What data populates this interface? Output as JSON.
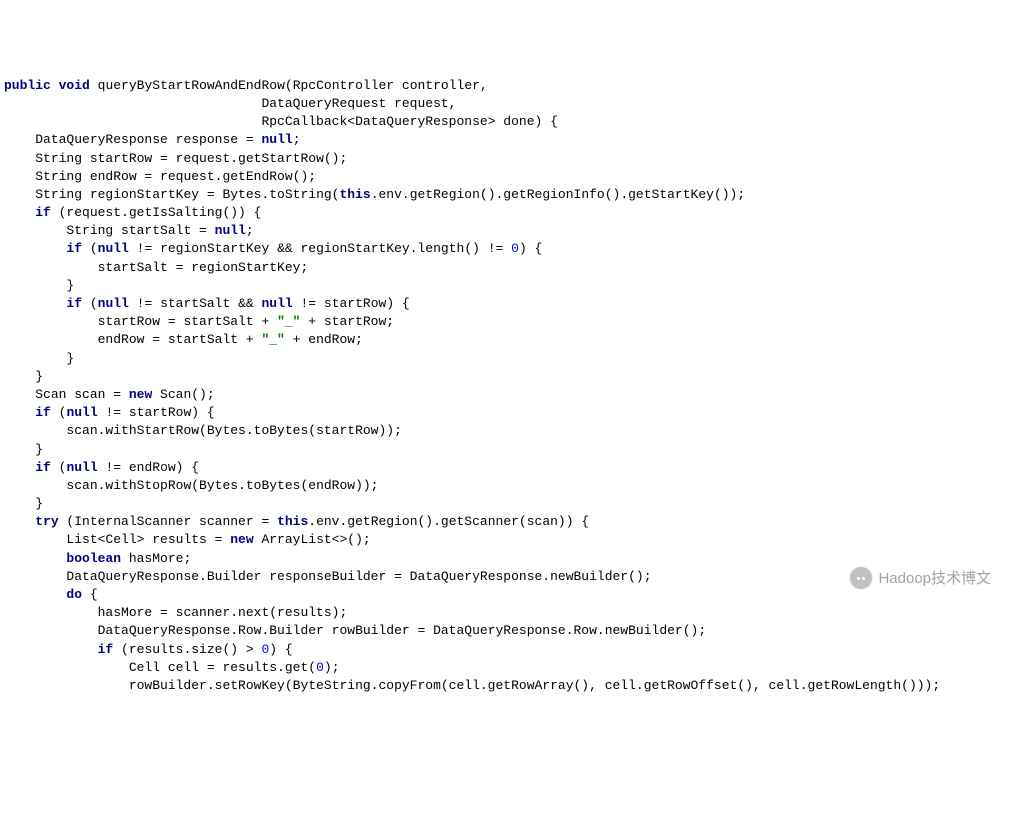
{
  "code": {
    "lines": [
      {
        "indent": 0,
        "tokens": [
          {
            "t": "kw",
            "v": "public"
          },
          {
            "t": "sp",
            "v": " "
          },
          {
            "t": "kw",
            "v": "void"
          },
          {
            "t": "sp",
            "v": " "
          },
          {
            "t": "txt",
            "v": "queryByStartRowAndEndRow(RpcController controller,"
          }
        ]
      },
      {
        "indent": 33,
        "tokens": [
          {
            "t": "txt",
            "v": "DataQueryRequest request,"
          }
        ]
      },
      {
        "indent": 33,
        "tokens": [
          {
            "t": "txt",
            "v": "RpcCallback<DataQueryResponse> done) {"
          }
        ]
      },
      {
        "indent": 4,
        "tokens": [
          {
            "t": "txt",
            "v": "DataQueryResponse response = "
          },
          {
            "t": "kw",
            "v": "null"
          },
          {
            "t": "txt",
            "v": ";"
          }
        ]
      },
      {
        "indent": 4,
        "tokens": [
          {
            "t": "txt",
            "v": "String startRow = request.getStartRow();"
          }
        ]
      },
      {
        "indent": 4,
        "tokens": [
          {
            "t": "txt",
            "v": "String endRow = request.getEndRow();"
          }
        ]
      },
      {
        "indent": 4,
        "tokens": [
          {
            "t": "txt",
            "v": "String regionStartKey = Bytes.toString("
          },
          {
            "t": "kw",
            "v": "this"
          },
          {
            "t": "txt",
            "v": ".env.getRegion().getRegionInfo().getStartKey());"
          }
        ]
      },
      {
        "indent": 4,
        "tokens": [
          {
            "t": "kw",
            "v": "if"
          },
          {
            "t": "txt",
            "v": " (request.getIsSalting()) {"
          }
        ]
      },
      {
        "indent": 8,
        "tokens": [
          {
            "t": "txt",
            "v": "String startSalt = "
          },
          {
            "t": "kw",
            "v": "null"
          },
          {
            "t": "txt",
            "v": ";"
          }
        ]
      },
      {
        "indent": 8,
        "tokens": [
          {
            "t": "kw",
            "v": "if"
          },
          {
            "t": "txt",
            "v": " ("
          },
          {
            "t": "kw",
            "v": "null"
          },
          {
            "t": "txt",
            "v": " != regionStartKey && regionStartKey.length() != "
          },
          {
            "t": "num",
            "v": "0"
          },
          {
            "t": "txt",
            "v": ") {"
          }
        ]
      },
      {
        "indent": 12,
        "tokens": [
          {
            "t": "txt",
            "v": "startSalt = regionStartKey;"
          }
        ]
      },
      {
        "indent": 8,
        "tokens": [
          {
            "t": "txt",
            "v": "}"
          }
        ]
      },
      {
        "indent": 8,
        "tokens": [
          {
            "t": "kw",
            "v": "if"
          },
          {
            "t": "txt",
            "v": " ("
          },
          {
            "t": "kw",
            "v": "null"
          },
          {
            "t": "txt",
            "v": " != startSalt && "
          },
          {
            "t": "kw",
            "v": "null"
          },
          {
            "t": "txt",
            "v": " != startRow) {"
          }
        ]
      },
      {
        "indent": 12,
        "tokens": [
          {
            "t": "txt",
            "v": "startRow = startSalt + "
          },
          {
            "t": "str",
            "v": "\"_\""
          },
          {
            "t": "txt",
            "v": " + startRow;"
          }
        ]
      },
      {
        "indent": 12,
        "tokens": [
          {
            "t": "txt",
            "v": "endRow = startSalt + "
          },
          {
            "t": "str",
            "v": "\"_\""
          },
          {
            "t": "txt",
            "v": " + endRow;"
          }
        ]
      },
      {
        "indent": 8,
        "tokens": [
          {
            "t": "txt",
            "v": "}"
          }
        ]
      },
      {
        "indent": 4,
        "tokens": [
          {
            "t": "txt",
            "v": "}"
          }
        ]
      },
      {
        "indent": 4,
        "tokens": [
          {
            "t": "txt",
            "v": "Scan scan = "
          },
          {
            "t": "kw",
            "v": "new"
          },
          {
            "t": "txt",
            "v": " Scan();"
          }
        ]
      },
      {
        "indent": 4,
        "tokens": [
          {
            "t": "kw",
            "v": "if"
          },
          {
            "t": "txt",
            "v": " ("
          },
          {
            "t": "kw",
            "v": "null"
          },
          {
            "t": "txt",
            "v": " != startRow) {"
          }
        ]
      },
      {
        "indent": 8,
        "tokens": [
          {
            "t": "txt",
            "v": "scan.withStartRow(Bytes.toBytes(startRow));"
          }
        ]
      },
      {
        "indent": 4,
        "tokens": [
          {
            "t": "txt",
            "v": "}"
          }
        ]
      },
      {
        "indent": 4,
        "tokens": [
          {
            "t": "kw",
            "v": "if"
          },
          {
            "t": "txt",
            "v": " ("
          },
          {
            "t": "kw",
            "v": "null"
          },
          {
            "t": "txt",
            "v": " != endRow) {"
          }
        ]
      },
      {
        "indent": 8,
        "tokens": [
          {
            "t": "txt",
            "v": "scan.withStopRow(Bytes.toBytes(endRow));"
          }
        ]
      },
      {
        "indent": 4,
        "tokens": [
          {
            "t": "txt",
            "v": "}"
          }
        ]
      },
      {
        "indent": 4,
        "tokens": [
          {
            "t": "kw",
            "v": "try"
          },
          {
            "t": "txt",
            "v": " (InternalScanner scanner = "
          },
          {
            "t": "kw",
            "v": "this"
          },
          {
            "t": "txt",
            "v": ".env.getRegion().getScanner(scan)) {"
          }
        ]
      },
      {
        "indent": 8,
        "tokens": [
          {
            "t": "txt",
            "v": "List<Cell> results = "
          },
          {
            "t": "kw",
            "v": "new"
          },
          {
            "t": "txt",
            "v": " ArrayList<>();"
          }
        ]
      },
      {
        "indent": 8,
        "tokens": [
          {
            "t": "kw",
            "v": "boolean"
          },
          {
            "t": "txt",
            "v": " hasMore;"
          }
        ]
      },
      {
        "indent": 8,
        "tokens": [
          {
            "t": "txt",
            "v": "DataQueryResponse.Builder responseBuilder = DataQueryResponse.newBuilder();"
          }
        ]
      },
      {
        "indent": 8,
        "tokens": [
          {
            "t": "kw",
            "v": "do"
          },
          {
            "t": "txt",
            "v": " {"
          }
        ]
      },
      {
        "indent": 12,
        "tokens": [
          {
            "t": "txt",
            "v": "hasMore = scanner.next(results);"
          }
        ]
      },
      {
        "indent": 12,
        "tokens": [
          {
            "t": "txt",
            "v": "DataQueryResponse.Row.Builder rowBuilder = DataQueryResponse.Row.newBuilder();"
          }
        ]
      },
      {
        "indent": 12,
        "tokens": [
          {
            "t": "kw",
            "v": "if"
          },
          {
            "t": "txt",
            "v": " (results.size() > "
          },
          {
            "t": "num",
            "v": "0"
          },
          {
            "t": "txt",
            "v": ") {"
          }
        ]
      },
      {
        "indent": 16,
        "tokens": [
          {
            "t": "txt",
            "v": "Cell cell = results."
          },
          {
            "t": "method",
            "v": "get"
          },
          {
            "t": "txt",
            "v": "("
          },
          {
            "t": "num",
            "v": "0"
          },
          {
            "t": "txt",
            "v": ");"
          }
        ]
      },
      {
        "indent": 16,
        "tokens": [
          {
            "t": "txt",
            "v": "rowBuilder.setRowKey(ByteString.copyFrom(cell.getRowArray(), cell.getRowOffset(), cell.getRowLength()));"
          }
        ]
      }
    ]
  },
  "watermark": {
    "text": "Hadoop技术博文"
  }
}
